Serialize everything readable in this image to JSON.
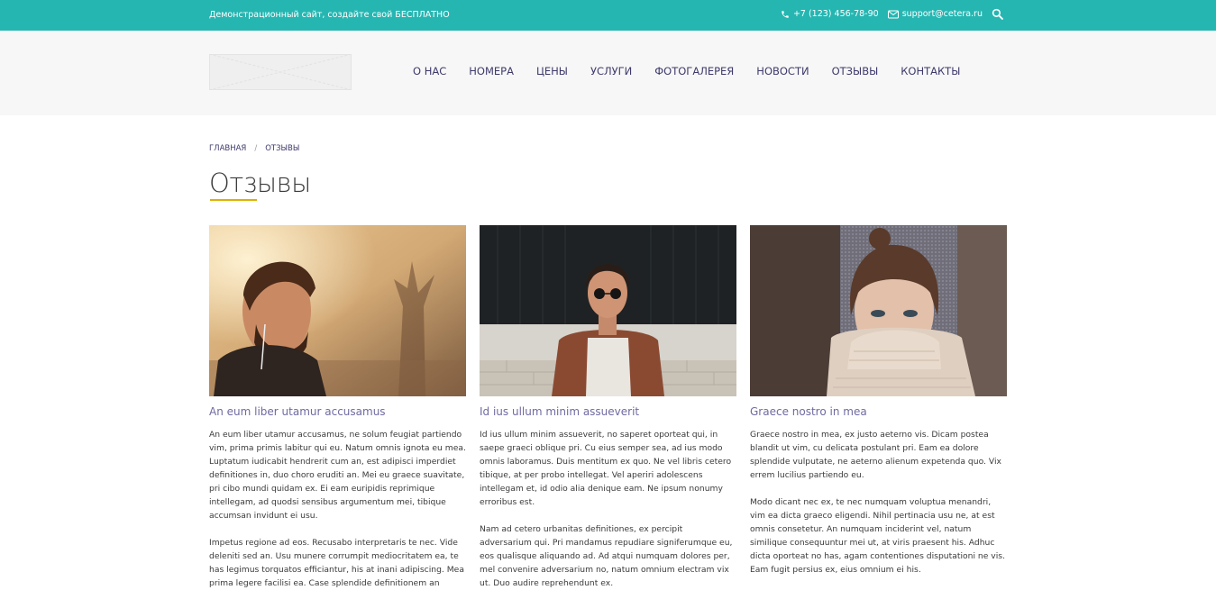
{
  "topbar": {
    "promo_text": "Демонстрационный сайт, создайте свой БЕСПЛАТНО",
    "phone": "+7 (123) 456-78-90",
    "email": "support@cetera.ru",
    "phone_icon": "phone-icon",
    "email_icon": "envelope-icon",
    "search_icon": "search-icon",
    "background_color": "#26b6b2"
  },
  "nav": {
    "items": [
      {
        "label": "О НАС"
      },
      {
        "label": "НОМЕРА"
      },
      {
        "label": "ЦЕНЫ"
      },
      {
        "label": "УСЛУГИ"
      },
      {
        "label": "ФОТОГАЛЕРЕЯ"
      },
      {
        "label": "НОВОСТИ"
      },
      {
        "label": "ОТЗЫВЫ"
      },
      {
        "label": "КОНТАКТЫ"
      }
    ]
  },
  "breadcrumb": {
    "home": "ГЛАВНАЯ",
    "separator": "/",
    "current": "ОТЗЫВЫ"
  },
  "page": {
    "title": "Отзывы",
    "accent_color": "#e0b100"
  },
  "reviews": [
    {
      "name": "An eum liber utamur accusamus",
      "paragraphs": [
        "An eum liber utamur accusamus, ne solum feugiat partiendo vim, prima primis labitur qui eu. Natum omnis ignota eu mea. Luptatum iudicabit hendrerit cum an, est adipisci imperdiet definitiones in, duo choro eruditi an. Mei eu graece suavitate, pri cibo mundi quidam ex. Ei eam euripidis reprimique intellegam, ad quodsi sensibus argumentum mei, tibique accumsan invidunt ei usu.",
        "Impetus regione ad eos. Recusabo interpretaris te nec. Vide deleniti sed an. Usu munere corrumpit mediocritatem ea, te has legimus torquatos efficiantur, his at inani adipiscing. Mea prima legere facilisi ea. Case splendide definitionem an"
      ]
    },
    {
      "name": "Id ius ullum minim assueverit",
      "paragraphs": [
        "Id ius ullum minim assueverit, no saperet oporteat qui, in saepe graeci oblique pri. Cu eius semper sea, ad ius modo omnis laboramus. Duis mentitum ex quo. Ne vel libris cetero tibique, at per probo intellegat. Vel aperiri adolescens intellegam et, id odio alia denique eam. Ne ipsum nonumy erroribus est.",
        "Nam ad cetero urbanitas definitiones, ex percipit adversarium qui. Pri mandamus repudiare signiferumque eu, eos qualisque aliquando ad. Ad atqui numquam dolores per, mel convenire adversarium no, natum omnium electram vix ut. Duo audire reprehendunt ex."
      ]
    },
    {
      "name": "Graece nostro in mea",
      "paragraphs": [
        "Graece nostro in mea, ex justo aeterno vis. Dicam postea blandit ut vim, cu delicata postulant pri. Eam ea dolore splendide vulputate, ne aeterno alienum expetenda quo. Vix errem lucilius partiendo eu.",
        "Modo dicant nec ex, te nec numquam voluptua menandri, vim ea dicta graeco eligendi. Nihil pertinacia usu ne, at est omnis consetetur. An numquam inciderint vel, natum similique consequuntur mei ut, at viris praesent his. Adhuc dicta oporteat no has, agam contentiones disputationi ne vis. Eam fugit persius ex, eius omnium ei his."
      ]
    }
  ]
}
